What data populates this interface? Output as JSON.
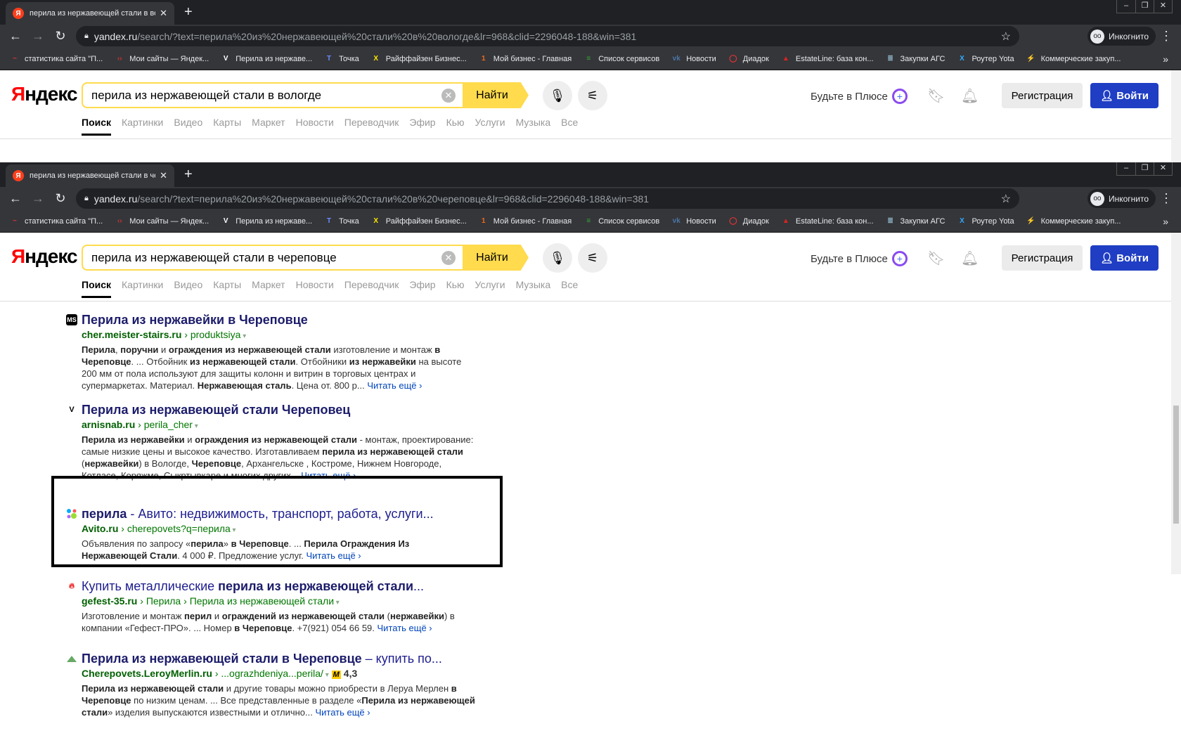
{
  "windows": [
    {
      "tab_title": "перила из нержавеющей стали в вологде",
      "url_host": "yandex.ru",
      "url_path": "/search/?text=перила%20из%20нержавеющей%20стали%20в%20вологде&lr=968&clid=2296048-188&win=381",
      "query": "перила из нержавеющей стали в вологде"
    },
    {
      "tab_title": "перила из нержавеющей стали в череповце",
      "url_host": "yandex.ru",
      "url_path": "/search/?text=перила%20из%20нержавеющей%20стали%20в%20череповце&lr=968&clid=2296048-188&win=381",
      "query": "перила из нержавеющей стали в череповце"
    }
  ],
  "browser": {
    "incognito": "Инкогнито",
    "new_tab": "+",
    "more_bookmarks": "»"
  },
  "bookmarks": [
    {
      "label": "статистика сайта \"П...",
      "color": "#d33",
      "glyph": "~"
    },
    {
      "label": "Мои сайты — Яндек...",
      "color": "#c33",
      "glyph": "‹›"
    },
    {
      "label": "Перила из нержаве...",
      "color": "#fff",
      "glyph": "V"
    },
    {
      "label": "Точка",
      "color": "#6a8cff",
      "glyph": "T"
    },
    {
      "label": "Райффайзен Бизнес...",
      "color": "#fee600",
      "glyph": "X"
    },
    {
      "label": "Мой бизнес - Главная",
      "color": "#f06a1d",
      "glyph": "1"
    },
    {
      "label": "Список сервисов",
      "color": "#3a3",
      "glyph": "≡"
    },
    {
      "label": "Новости",
      "color": "#4a76a8",
      "glyph": "vk"
    },
    {
      "label": "Диадок",
      "color": "#e33",
      "glyph": "◯"
    },
    {
      "label": "EstateLine: база кон...",
      "color": "#d22",
      "glyph": "▲"
    },
    {
      "label": "Закупки АГС",
      "color": "#8ab",
      "glyph": "≣"
    },
    {
      "label": "Роутер Yota",
      "color": "#3af",
      "glyph": "X"
    },
    {
      "label": "Коммерческие закуп...",
      "color": "#7ab",
      "glyph": "⚡"
    }
  ],
  "yandex": {
    "logo": "Яндекс",
    "search_button": "Найти",
    "plus": "Будьте в Плюсе",
    "register": "Регистрация",
    "login": "Войти",
    "services": [
      "Поиск",
      "Картинки",
      "Видео",
      "Карты",
      "Маркет",
      "Новости",
      "Переводчик",
      "Эфир",
      "Кью",
      "Услуги",
      "Музыка",
      "Все"
    ]
  },
  "results": [
    {
      "icon": "MS",
      "icon_color": "#000",
      "title": [
        {
          "t": "Перила из нержавейки в Череповце",
          "b": true
        }
      ],
      "domain": "cher.meister-stairs.ru",
      "path": [
        "produktsiya"
      ],
      "snippet": [
        {
          "t": "Перила",
          "b": true
        },
        {
          "t": ", "
        },
        {
          "t": "поручни",
          "b": true
        },
        {
          "t": " и "
        },
        {
          "t": "ограждения из нержавеющей стали",
          "b": true
        },
        {
          "t": " изготовление и монтаж "
        },
        {
          "t": "в Череповце",
          "b": true
        },
        {
          "t": ". ... Отбойник "
        },
        {
          "t": "из нержавеющей стали",
          "b": true
        },
        {
          "t": ". Отбойники "
        },
        {
          "t": "из нержавейки",
          "b": true
        },
        {
          "t": " на высоте 200 мм от пола используют для защиты колонн и витрин в торговых центрах и супермаркетах. Материал. "
        },
        {
          "t": "Нержавеющая сталь",
          "b": true
        },
        {
          "t": ". Цена от. 800 р... "
        }
      ],
      "more": "Читать ещё ›"
    },
    {
      "icon": "V",
      "icon_color": "#fff",
      "title": [
        {
          "t": "Перила из нержавеющей стали Череповец",
          "b": true
        }
      ],
      "domain": "arnisnab.ru",
      "path": [
        "perila_cher"
      ],
      "snippet": [
        {
          "t": "Перила из нержавейки",
          "b": true
        },
        {
          "t": " и "
        },
        {
          "t": "ограждения из нержавеющей стали",
          "b": true
        },
        {
          "t": " - монтаж, проектирование: самые низкие цены и высокое качество. Изготавливаем "
        },
        {
          "t": "перила из нержавеющей стали",
          "b": true
        },
        {
          "t": " ("
        },
        {
          "t": "нержавейки",
          "b": true
        },
        {
          "t": ") в Вологде, "
        },
        {
          "t": "Череповце",
          "b": true
        },
        {
          "t": ", Архангельске , Костроме, Нижнем Новгороде, Котласе, Коряжме, Сыкртывкаре и многих других... "
        }
      ],
      "more": "Читать ещё ›"
    },
    {
      "icon": "avito",
      "icon_color": "#fff",
      "title": [
        {
          "t": "перила",
          "b": true
        },
        {
          "t": " - Авито: недвижимость, транспорт, работа, услуги..."
        }
      ],
      "domain": "Avito.ru",
      "path": [
        "cherepovets?q=перила"
      ],
      "snippet": [
        {
          "t": "Объявления по запросу «"
        },
        {
          "t": "перила",
          "b": true
        },
        {
          "t": "» "
        },
        {
          "t": "в Череповце",
          "b": true
        },
        {
          "t": ". ... "
        },
        {
          "t": "Перила Ограждения Из Нержавеющей Стали",
          "b": true
        },
        {
          "t": ". 4 000 ₽. Предложение услуг. "
        }
      ],
      "more": "Читать ещё ›"
    },
    {
      "icon": "flame",
      "icon_color": "#fff",
      "title": [
        {
          "t": "Купить металлические "
        },
        {
          "t": "перила из нержавеющей стали",
          "b": true
        },
        {
          "t": "..."
        }
      ],
      "domain": "gefest-35.ru",
      "path": [
        "Перила",
        "Перила из нержавеющей стали"
      ],
      "snippet": [
        {
          "t": "Изготовление и монтаж "
        },
        {
          "t": "перил",
          "b": true
        },
        {
          "t": " и "
        },
        {
          "t": "ограждений из нержавеющей стали",
          "b": true
        },
        {
          "t": " ("
        },
        {
          "t": "нержавейки",
          "b": true
        },
        {
          "t": ") в компании «Гефест-ПРО». ... Номер "
        },
        {
          "t": "в Череповце",
          "b": true
        },
        {
          "t": ". +7(921) 054 66 59. "
        }
      ],
      "more": "Читать ещё ›"
    },
    {
      "icon": "leroy",
      "icon_color": "#fff",
      "title": [
        {
          "t": "Перила из нержавеющей стали в Череповце",
          "b": true
        },
        {
          "t": " – купить по..."
        }
      ],
      "domain": "Cherepovets.LeroyMerlin.ru",
      "path": [
        "...ograzhdeniya...perila/"
      ],
      "rating": "4,3",
      "snippet": [
        {
          "t": "Перила из нержавеющей стали",
          "b": true
        },
        {
          "t": " и другие товары можно приобрести в Леруа Мерлен "
        },
        {
          "t": "в Череповце",
          "b": true
        },
        {
          "t": " по низким ценам. ... Все представленные в разделе «"
        },
        {
          "t": "Перила из нержавеющей стали",
          "b": true
        },
        {
          "t": "» изделия выпускаются известными и отлично... "
        }
      ],
      "more": "Читать ещё ›"
    }
  ]
}
